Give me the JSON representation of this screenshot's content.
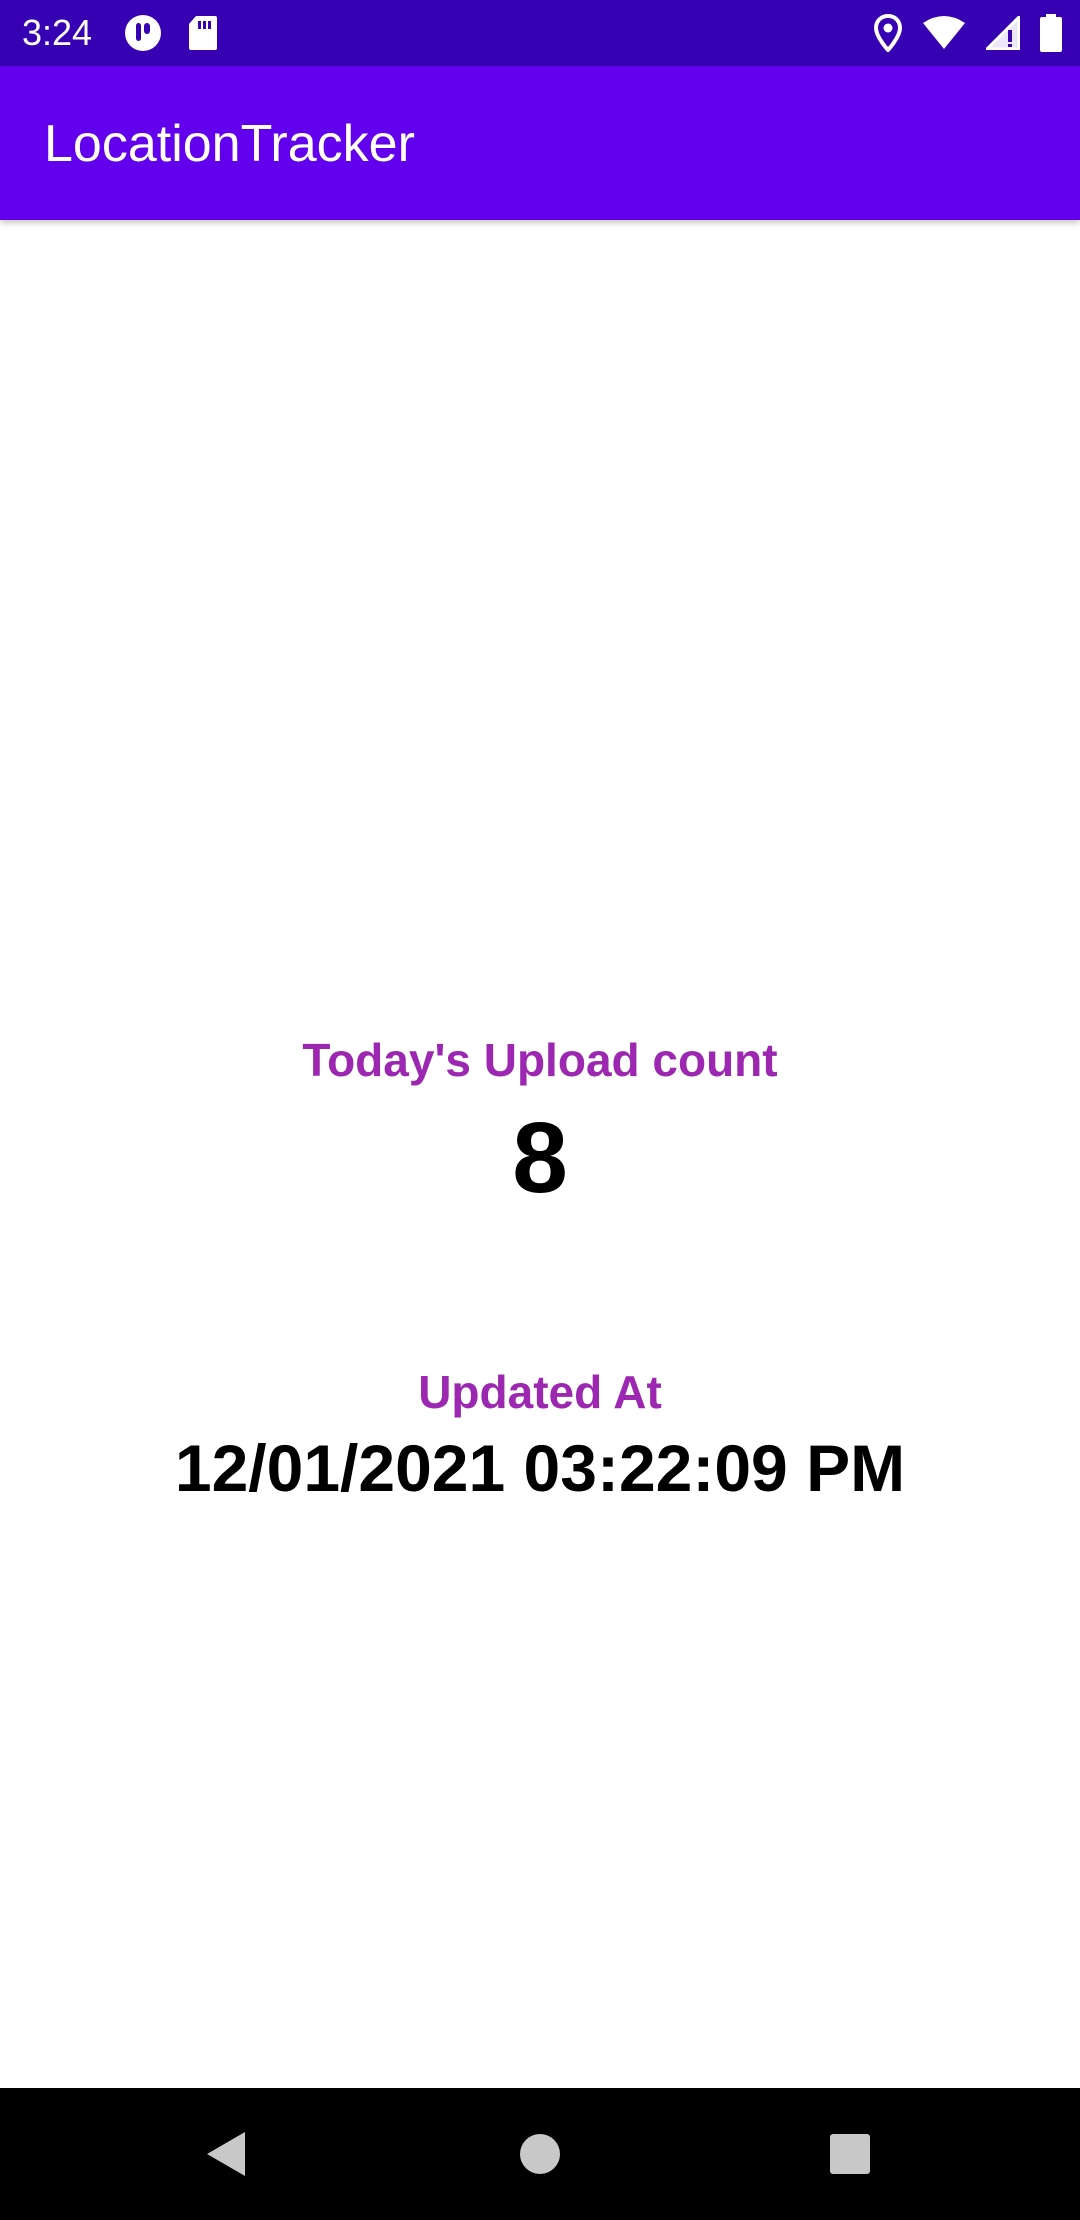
{
  "status_bar": {
    "time": "3:24",
    "left_icons": [
      "podcast-app-icon",
      "sd-card-icon"
    ],
    "right_icons": [
      "location-icon",
      "wifi-icon",
      "cellular-signal-icon",
      "battery-icon"
    ]
  },
  "app_bar": {
    "title": "LocationTracker"
  },
  "main": {
    "upload_label": "Today's Upload count",
    "upload_count": "8",
    "updated_label": "Updated At",
    "updated_value": "12/01/2021 03:22:09 PM"
  },
  "nav_bar": {
    "buttons": [
      "back-icon",
      "home-icon",
      "recents-icon"
    ]
  },
  "colors": {
    "status_bar": "#3700b3",
    "app_bar": "#6200ee",
    "label_accent": "#9c27b0",
    "value_text": "#000000",
    "nav_bar": "#000000"
  }
}
